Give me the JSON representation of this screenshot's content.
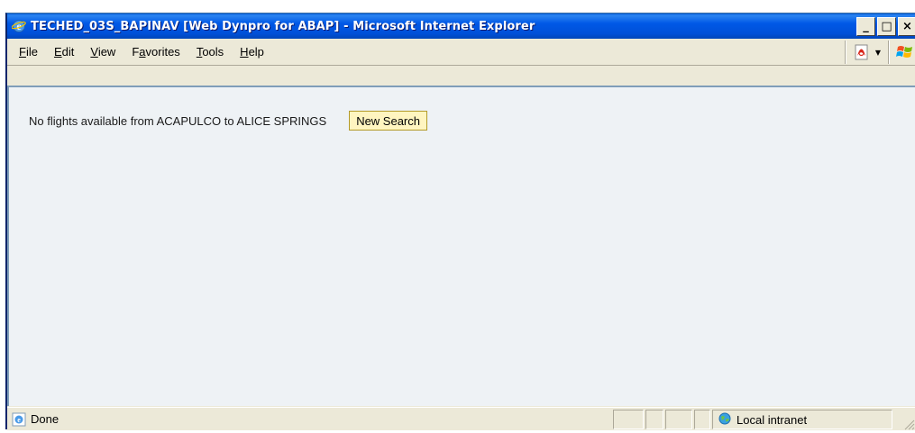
{
  "window": {
    "title": "TECHED_03S_BAPINAV [Web Dynpro for ABAP] - Microsoft Internet Explorer",
    "minimize": "_",
    "maximize": "□",
    "close": "×"
  },
  "menu": {
    "file": {
      "pre": "",
      "key": "F",
      "post": "ile"
    },
    "edit": {
      "pre": "",
      "key": "E",
      "post": "dit"
    },
    "view": {
      "pre": "",
      "key": "V",
      "post": "iew"
    },
    "favorites": {
      "pre": "F",
      "key": "a",
      "post": "vorites"
    },
    "tools": {
      "pre": "",
      "key": "T",
      "post": "ools"
    },
    "help": {
      "pre": "",
      "key": "H",
      "post": "elp"
    }
  },
  "content": {
    "message": "No flights available from ACAPULCO to ALICE SPRINGS",
    "new_search_label": "New Search"
  },
  "status": {
    "text": "Done",
    "zone": "Local intranet"
  },
  "icons": {
    "ie": "ie-icon",
    "pdf": "pdf-icon",
    "windows": "windows-flag-icon",
    "intranet": "local-intranet-icon"
  },
  "colors": {
    "titlebar": "#0058e6",
    "content_bg": "#eef2f5",
    "button_bg": "#fff5c0"
  }
}
